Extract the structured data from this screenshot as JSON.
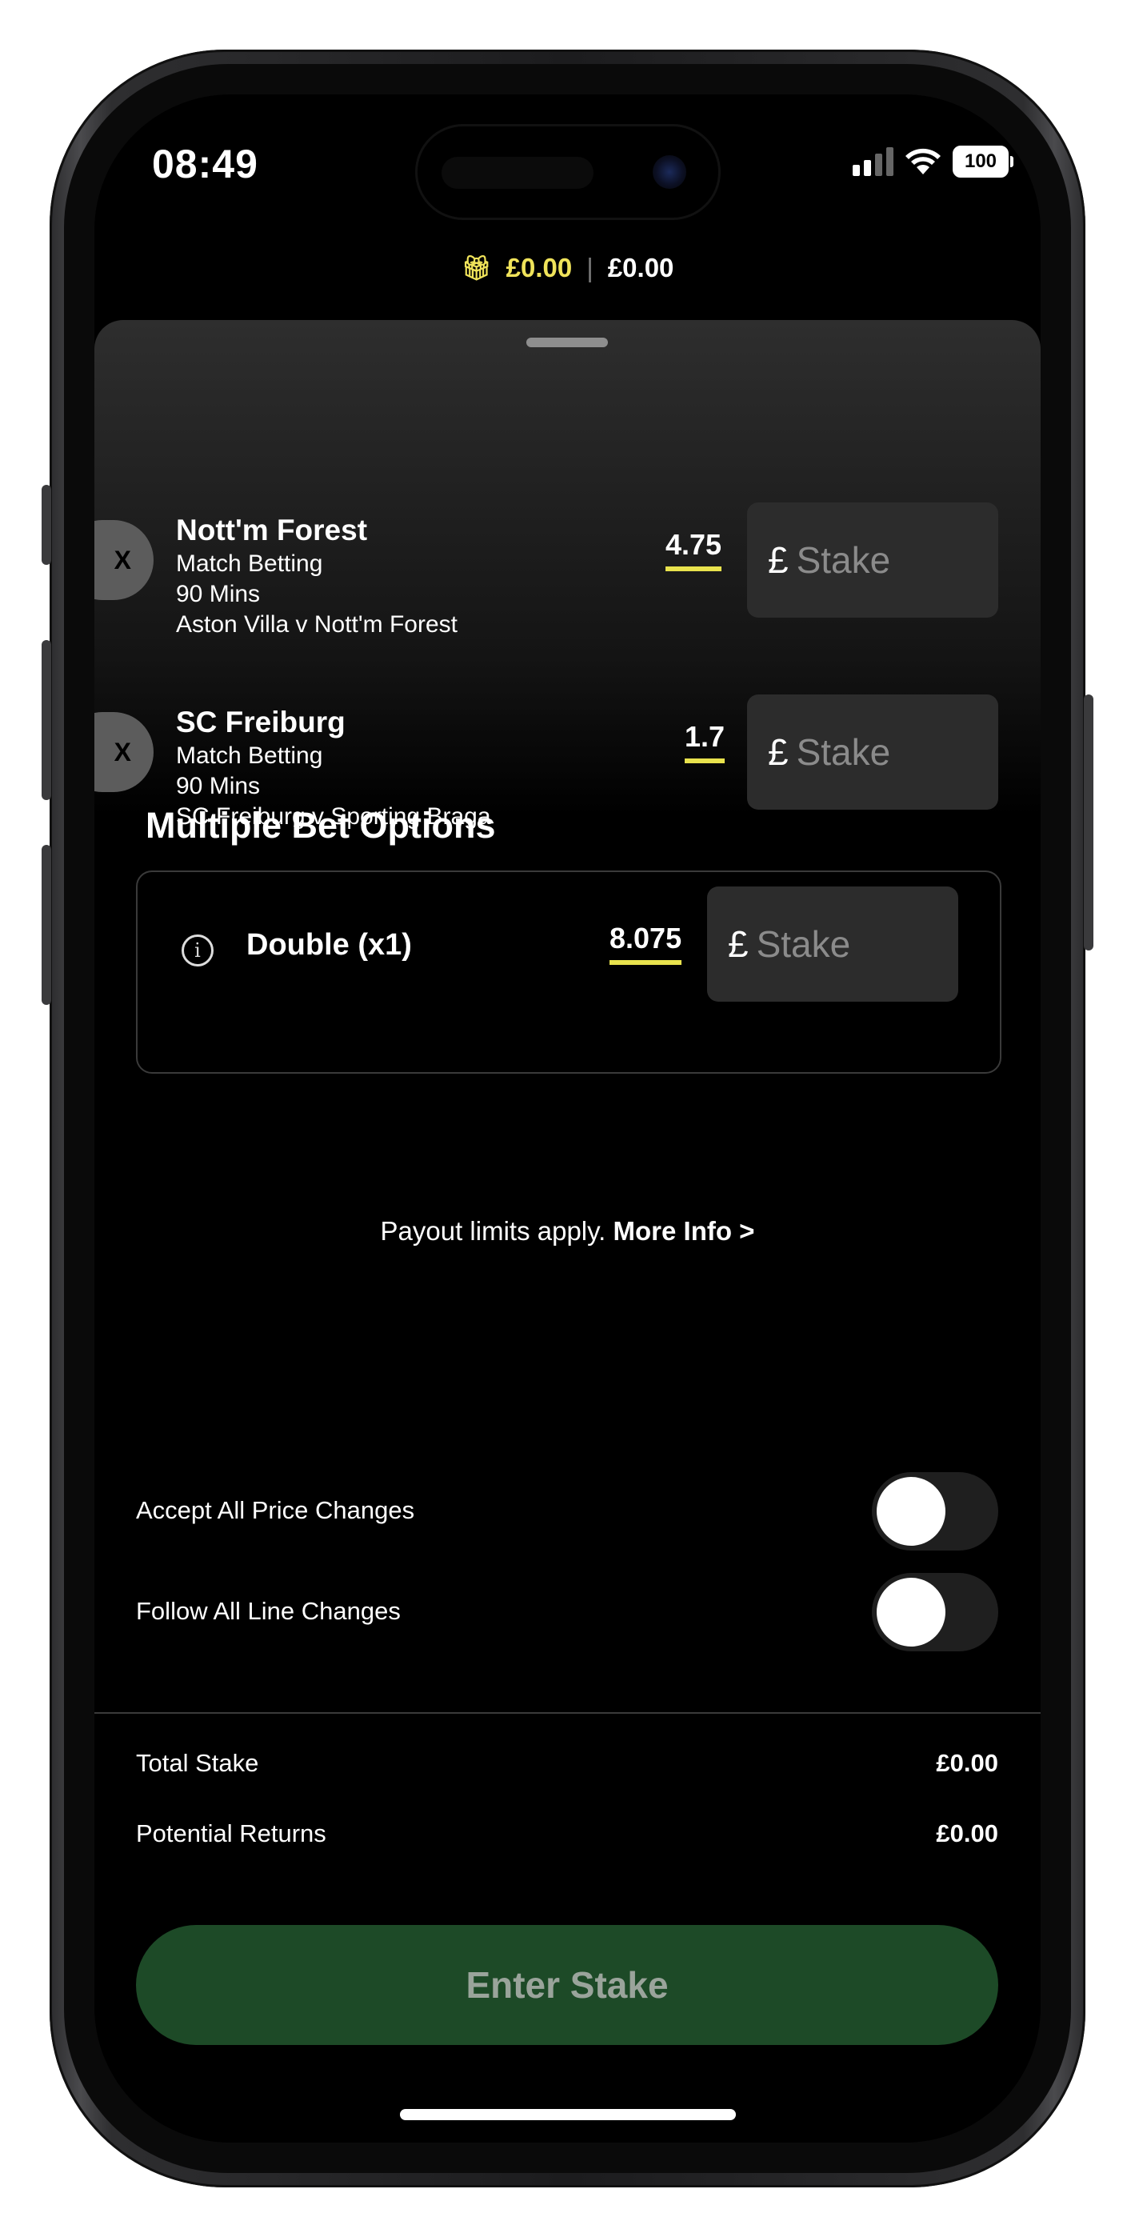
{
  "status_bar": {
    "time": "08:49",
    "battery": "100"
  },
  "balance": {
    "bonus": "£0.00",
    "cash": "£0.00",
    "separator": "|"
  },
  "selections": [
    {
      "remove": "X",
      "name": "Nott'm Forest",
      "market": "Match Betting",
      "period": "90 Mins",
      "event": "Aston Villa v Nott'm Forest",
      "odds": "4.75",
      "currency": "£",
      "stake_placeholder": "Stake"
    },
    {
      "remove": "X",
      "name": "SC Freiburg",
      "market": "Match Betting",
      "period": "90 Mins",
      "event": "SC Freiburg v Sporting Braga",
      "odds": "1.7",
      "currency": "£",
      "stake_placeholder": "Stake"
    }
  ],
  "multiples": {
    "title": "Multiple Bet Options",
    "info_icon": "i",
    "double": {
      "label": "Double (x1)",
      "odds": "8.075",
      "currency": "£",
      "stake_placeholder": "Stake"
    }
  },
  "payout": {
    "text": "Payout limits apply. ",
    "link": "More Info >"
  },
  "toggles": [
    {
      "label": "Accept All Price Changes",
      "on": false
    },
    {
      "label": "Follow All Line Changes",
      "on": false
    }
  ],
  "summary": {
    "total_stake_label": "Total Stake",
    "total_stake_value": "£0.00",
    "returns_label": "Potential Returns",
    "returns_value": "£0.00"
  },
  "cta": {
    "label": "Enter Stake"
  },
  "colors": {
    "accent": "#e8e24d",
    "cta_bg": "#1d4a27",
    "panel": "#2e2e2e"
  }
}
